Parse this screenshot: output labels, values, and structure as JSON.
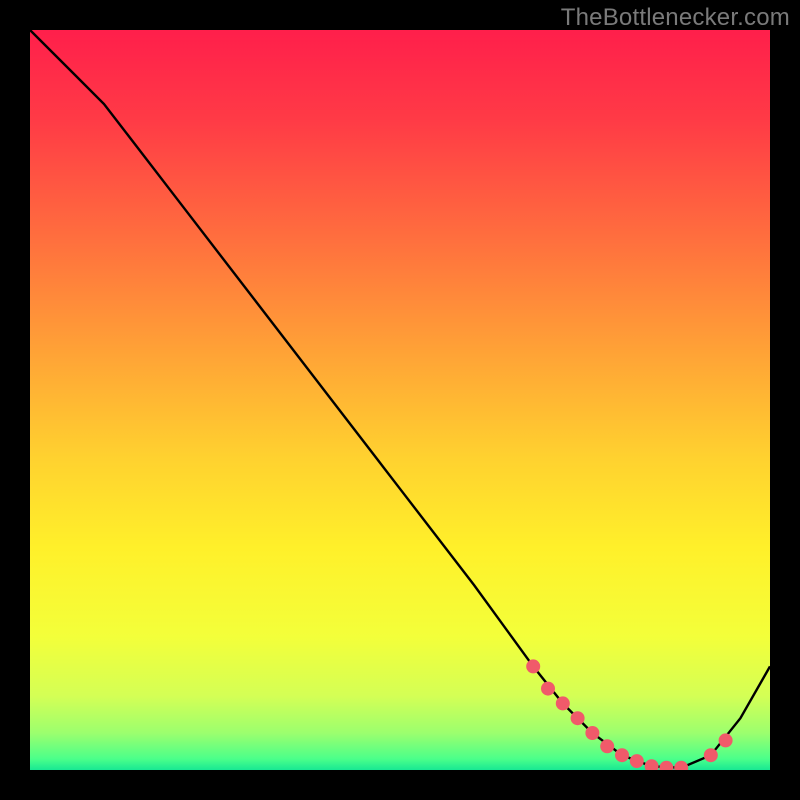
{
  "watermark": "TheBottlenecker.com",
  "chart_data": {
    "type": "line",
    "title": "",
    "xlabel": "",
    "ylabel": "",
    "xlim": [
      0,
      100
    ],
    "ylim": [
      0,
      100
    ],
    "grid": false,
    "series": [
      {
        "name": "curve",
        "x": [
          0,
          6,
          10,
          20,
          30,
          40,
          50,
          60,
          68,
          72,
          76,
          80,
          84,
          88,
          92,
          96,
          100
        ],
        "y": [
          100,
          94,
          90,
          77,
          64,
          51,
          38,
          25,
          14,
          9,
          5,
          2,
          0.5,
          0.3,
          2,
          7,
          14
        ]
      }
    ],
    "markers": {
      "name": "dots",
      "color": "#f05a6a",
      "x": [
        68,
        70,
        72,
        74,
        76,
        78,
        80,
        82,
        84,
        86,
        88,
        92,
        94
      ],
      "y": [
        14,
        11,
        9,
        7,
        5,
        3.2,
        2,
        1.2,
        0.5,
        0.3,
        0.3,
        2,
        4
      ]
    },
    "gradient_stops": [
      {
        "offset": 0.0,
        "color": "#ff1f4b"
      },
      {
        "offset": 0.12,
        "color": "#ff3a46"
      },
      {
        "offset": 0.28,
        "color": "#ff6e3e"
      },
      {
        "offset": 0.44,
        "color": "#ffa436"
      },
      {
        "offset": 0.58,
        "color": "#ffd22f"
      },
      {
        "offset": 0.7,
        "color": "#fff02a"
      },
      {
        "offset": 0.82,
        "color": "#f3ff3a"
      },
      {
        "offset": 0.9,
        "color": "#d4ff55"
      },
      {
        "offset": 0.95,
        "color": "#9cff6e"
      },
      {
        "offset": 0.985,
        "color": "#4bff8a"
      },
      {
        "offset": 1.0,
        "color": "#18e893"
      }
    ]
  }
}
